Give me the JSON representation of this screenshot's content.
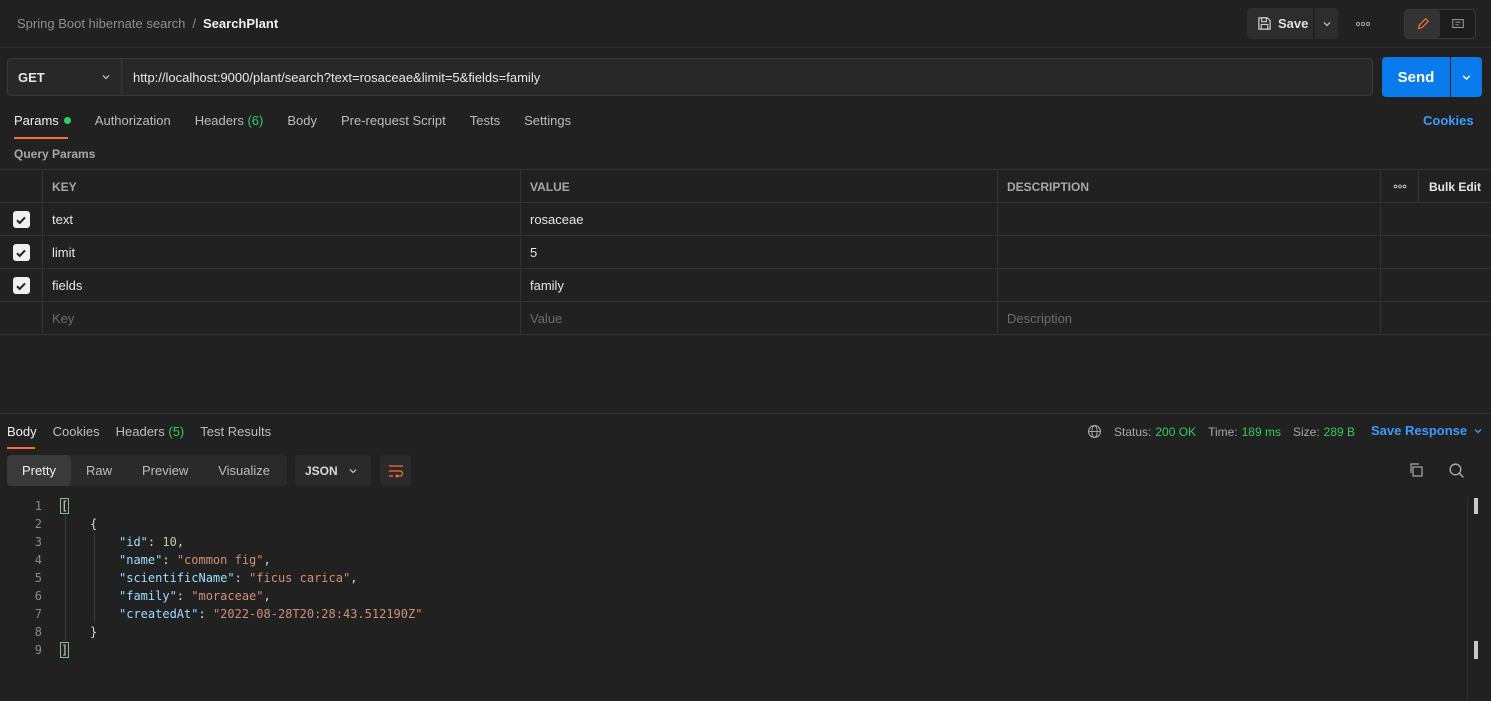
{
  "breadcrumb": {
    "parent": "Spring Boot hibernate search",
    "separator": "/",
    "current": "SearchPlant"
  },
  "toolbar": {
    "save_label": "Save"
  },
  "request": {
    "method": "GET",
    "url": "http://localhost:9000/plant/search?text=rosaceae&limit=5&fields=family",
    "send_label": "Send"
  },
  "request_tabs": [
    {
      "label": "Params",
      "count": ""
    },
    {
      "label": "Authorization",
      "count": ""
    },
    {
      "label": "Headers",
      "count": "(6)"
    },
    {
      "label": "Body",
      "count": ""
    },
    {
      "label": "Pre-request Script",
      "count": ""
    },
    {
      "label": "Tests",
      "count": ""
    },
    {
      "label": "Settings",
      "count": ""
    }
  ],
  "cookies_label": "Cookies",
  "query_params_label": "Query Params",
  "params_table": {
    "headers": {
      "key": "KEY",
      "value": "VALUE",
      "description": "DESCRIPTION",
      "bulk_edit": "Bulk Edit"
    },
    "rows": [
      {
        "key": "text",
        "value": "rosaceae",
        "description": ""
      },
      {
        "key": "limit",
        "value": "5",
        "description": ""
      },
      {
        "key": "fields",
        "value": "family",
        "description": ""
      }
    ],
    "placeholders": {
      "key": "Key",
      "value": "Value",
      "description": "Description"
    }
  },
  "response_tabs": [
    {
      "label": "Body",
      "count": ""
    },
    {
      "label": "Cookies",
      "count": ""
    },
    {
      "label": "Headers",
      "count": "(5)"
    },
    {
      "label": "Test Results",
      "count": ""
    }
  ],
  "response_status": {
    "status_label": "Status:",
    "status": "200 OK",
    "time_label": "Time:",
    "time": "189 ms",
    "size_label": "Size:",
    "size": "289 B",
    "save_response": "Save Response"
  },
  "view_tabs": [
    "Pretty",
    "Raw",
    "Preview",
    "Visualize"
  ],
  "format": "JSON",
  "response_body": {
    "line_numbers": [
      "1",
      "2",
      "3",
      "4",
      "5",
      "6",
      "7",
      "8",
      "9"
    ],
    "open_array": "[",
    "open_obj": "{",
    "fields": [
      {
        "key": "\"id\"",
        "value": "10",
        "type": "num",
        "comma": ","
      },
      {
        "key": "\"name\"",
        "value": "\"common fig\"",
        "type": "str",
        "comma": ","
      },
      {
        "key": "\"scientificName\"",
        "value": "\"ficus carica\"",
        "type": "str",
        "comma": ","
      },
      {
        "key": "\"family\"",
        "value": "\"moraceae\"",
        "type": "str",
        "comma": ","
      },
      {
        "key": "\"createdAt\"",
        "value": "\"2022-08-28T20:28:43.512190Z\"",
        "type": "str",
        "comma": ""
      }
    ],
    "close_obj": "}",
    "close_array": "]"
  },
  "colors": {
    "accent_orange": "#ff6c37",
    "send_blue": "#097bed",
    "link_blue": "#3b9cff",
    "status_green": "#2fcf62"
  }
}
